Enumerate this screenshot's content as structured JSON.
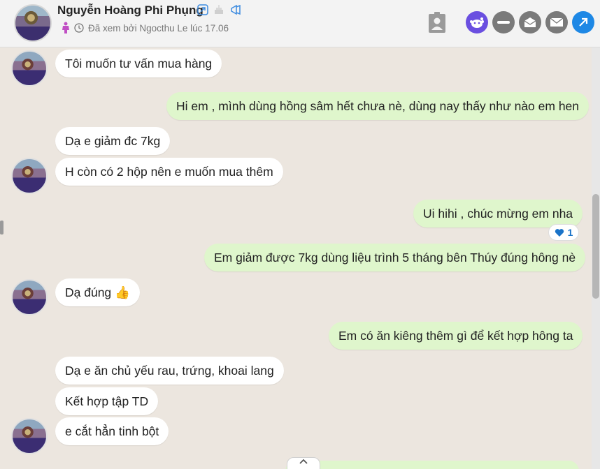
{
  "header": {
    "contact_name": "Nguyễn Hoàng Phi Phụng",
    "seen_status": "Đã xem bởi Ngocthu Le lúc 17.06",
    "icons": [
      "link-icon",
      "cake-icon",
      "megaphone-icon",
      "female-icon",
      "clock-icon",
      "contact-card-icon",
      "reddit-icon",
      "minus-icon",
      "mail-open-icon",
      "mail-icon",
      "forward-arrow-icon"
    ],
    "colors": {
      "reddit": "#6a4fe0",
      "gray_btn": "#7a7a7a",
      "forward": "#1e88e5",
      "female": "#c04fc4"
    }
  },
  "messages": [
    {
      "dir": "in",
      "text": "Tôi muốn tư vấn mua hàng"
    },
    {
      "dir": "out",
      "text": "Hi em , mình dùng hồng sâm hết chưa nè, dùng nay thấy như nào em hen"
    },
    {
      "dir": "in",
      "text": "Dạ e giảm đc 7kg"
    },
    {
      "dir": "in",
      "text": "H còn có 2 hộp nên e muốn mua thêm"
    },
    {
      "dir": "out",
      "text": "Ui hihi , chúc mừng em nha"
    },
    {
      "dir": "out",
      "text": "Em giảm được 7kg dùng liệu trình 5 tháng bên Thúy đúng hông nè"
    },
    {
      "dir": "in",
      "text": "Dạ đúng 👍"
    },
    {
      "dir": "out",
      "text": "Em có ăn kiêng thêm gì để kết hợp hông ta"
    },
    {
      "dir": "in",
      "text": "Dạ e ăn chủ yếu rau, trứng, khoai lang"
    },
    {
      "dir": "in",
      "text": "Kết hợp tập TD"
    },
    {
      "dir": "in",
      "text": "e cắt hẳn tinh bột"
    }
  ],
  "reaction": {
    "icon": "heart-icon",
    "count": "1"
  },
  "colors": {
    "chat_bg": "#ece6df",
    "incoming": "#ffffff",
    "outgoing": "#dff6cc"
  }
}
